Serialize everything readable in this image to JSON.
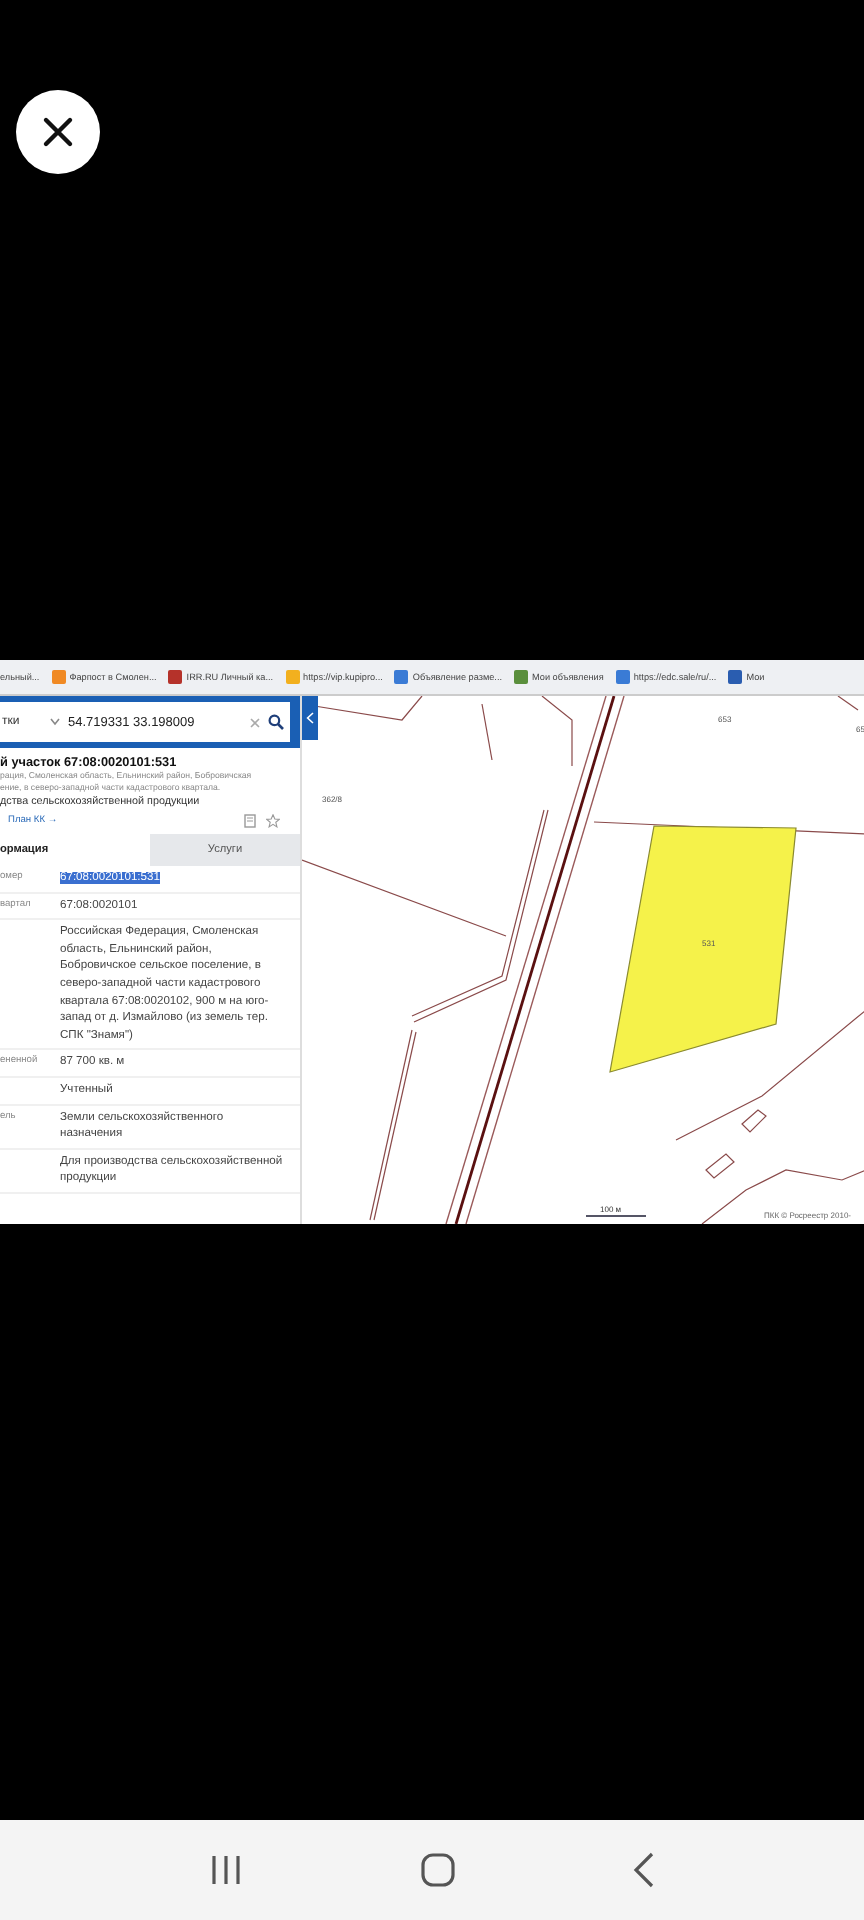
{
  "bookmarks": [
    {
      "label": "ельный..."
    },
    {
      "label": "Фарпост в Смолен...",
      "color": "#f08a24"
    },
    {
      "label": "IRR.RU Личный ка...",
      "color": "#b5322a"
    },
    {
      "label": "https://vip.kupipro...",
      "color": "#f2b01e"
    },
    {
      "label": "Объявление разме...",
      "color": "#3a7bd5"
    },
    {
      "label": "Мои объявления",
      "color": "#5a8f3c"
    },
    {
      "label": "https://edc.sale/ru/...",
      "color": "#3a7bd5"
    },
    {
      "label": "Мои",
      "color": "#2a5db0"
    }
  ],
  "search": {
    "layer": "тки",
    "value": "54.719331 33.198009"
  },
  "parcel": {
    "title": "й участок 67:08:0020101:531",
    "address_lines": [
      "рация, Смоленская область, Ельнинский район, Бобровичская",
      "ение, в северо-западной части кадастрового квартала."
    ],
    "purpose": "дства сельскохозяйственной продукции",
    "plan_link": "План КК →"
  },
  "tabs": [
    {
      "label": "ормация",
      "selected": true
    },
    {
      "label": "Услуги",
      "selected": false
    }
  ],
  "fields": [
    {
      "label": "омер",
      "value": "67:08:0020101:531",
      "highlighted": true
    },
    {
      "label": "вартал",
      "value": "67:08:0020101",
      "highlighted": false
    },
    {
      "value": "Российская Федерация, Смоленская область, Ельнинский район, Бобровичское сельское поселение, в северо-западной части кадастрового квартала 67:08:0020102, 900 м на юго-запад от д. Измайлово (из земель тер. СПК \"Знамя\")",
      "highlighted": false
    },
    {
      "label": "ененной",
      "value": "87 700 кв. м",
      "highlighted": false
    },
    {
      "value": "Учтенный",
      "highlighted": false
    },
    {
      "label": "ель",
      "value": "Земли сельскохозяйственного назначения",
      "highlighted": false
    },
    {
      "value": "Для производства сельскохозяйственной продукции",
      "highlighted": false
    }
  ],
  "map": {
    "parcel_numbers": [
      "362/8",
      "653",
      "531",
      "65"
    ],
    "scale": "100 м",
    "copyright": "ПКК © Росреестр 2010-"
  }
}
